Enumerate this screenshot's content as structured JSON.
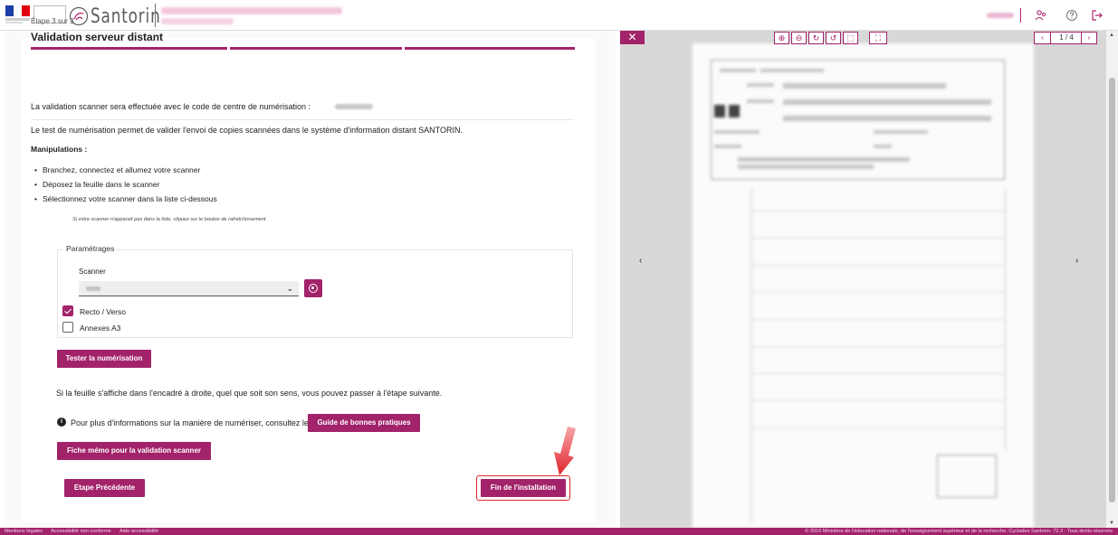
{
  "header": {
    "brand": "Santorin",
    "icons": [
      "users-icon",
      "help-icon",
      "logout-icon"
    ]
  },
  "step": {
    "label": "Étape 3 sur 3",
    "title": "Validation serveur distant"
  },
  "content": {
    "intro": "La validation scanner sera effectuée avec le code de centre de numérisation :",
    "test_description": "Le test de numérisation permet de valider l'envoi de copies scannées dans le système d'information distant SANTORIN.",
    "manipulations_title": "Manipulations :",
    "steps": [
      "Branchez, connectez et allumez votre scanner",
      "Déposez la feuille dans le scanner",
      "Sélectionnez votre scanner dans la liste ci-dessous"
    ],
    "hint": "Si votre scanner n'apparaît pas dans la liste, cliquez sur le bouton de rafraîchissement",
    "result_text": "Si la feuille s'affiche dans l'encadré à droite, quel que soit son sens, vous pouvez passer à l'étape suivante.",
    "info_text": "Pour plus d'informations sur la manière de numériser, consultez le"
  },
  "settings": {
    "legend": "Paramétrages",
    "scanner_label": "Scanner",
    "recto_verso_label": "Recto / Verso",
    "recto_verso_checked": true,
    "annexes_label": "Annexes A3",
    "annexes_checked": false
  },
  "buttons": {
    "tester": "Tester la numérisation",
    "guide": "Guide de bonnes pratiques",
    "fiche": "Fiche mémo pour la validation scanner",
    "previous": "Etape Précédente",
    "finish": "Fin de l'installation"
  },
  "viewer": {
    "close": "✕",
    "page_indicator": "1 / 4",
    "prev": "‹",
    "next": "›"
  },
  "footer": {
    "links": [
      "Mentions légales",
      "Accessibilité non conforme",
      "Aide accessibilité"
    ],
    "copyright": "© 2016 Ministère de l'éducation nationale, de l'enseignement supérieur et de la recherche. Cyclades Santorin- 72.3 - Tous droits réservés"
  },
  "colors": {
    "accent": "#a2236a",
    "annotation": "#e0242b"
  }
}
